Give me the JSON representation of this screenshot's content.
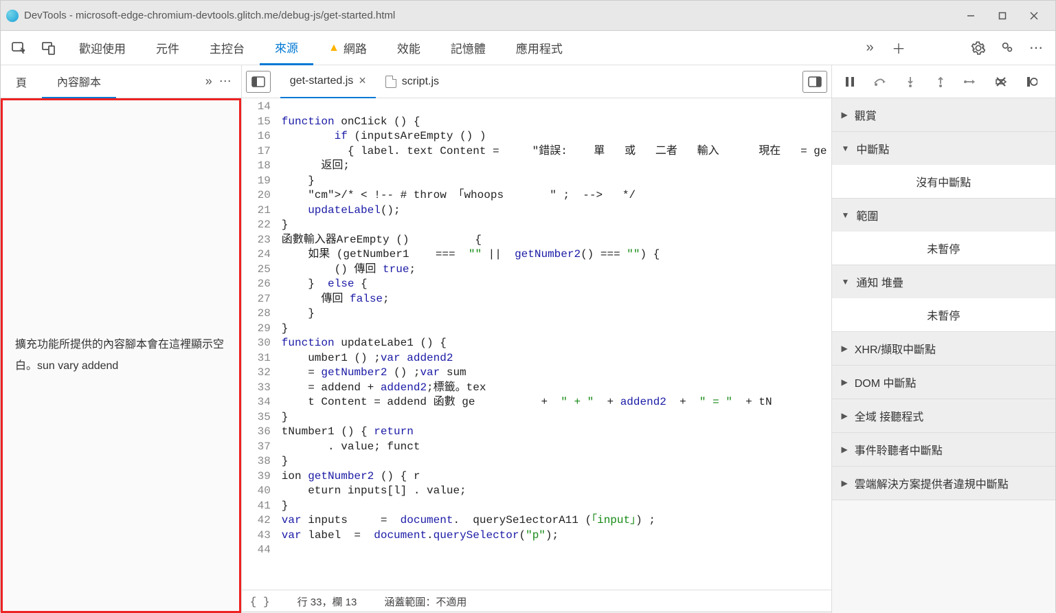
{
  "window": {
    "title": "DevTools - microsoft-edge-chromium-devtools.glitch.me/debug-js/get-started.html"
  },
  "tabs": {
    "welcome": "歡迎使用",
    "elements": "元件",
    "console": "主控台",
    "sources": "來源",
    "network": "網路",
    "performance": "效能",
    "memory": "記憶體",
    "application": "應用程式"
  },
  "left": {
    "page": "頁",
    "content_scripts": "內容腳本",
    "empty_msg": "擴充功能所提供的內容腳本會在這裡顯示空白。sun vary addend"
  },
  "files": {
    "active": "get-started.js",
    "other": "script.js"
  },
  "code_lines": [
    "",
    "function onC1ick () {",
    "        if (inputsAreEmpty () )",
    "          { label. text Content =     \"錯誤:    單   或   二者   輸入      現在   = ge",
    "      返回;",
    "    }",
    "    /* < !-- # throw 「whoops       \" ;  -->   */",
    "    updateLabel();",
    "}",
    "函數輸入器AreEmpty ()          {",
    "    如果 (getNumber1    ===  \"\" ||  getNumber2() === \"\") {",
    "        () 傳回 true;",
    "    }  else {",
    "      傳回 false;",
    "    }",
    "}",
    "function updateLabe1 () {",
    "    umber1 () ;var addend2",
    "    = getNumber2 () ;var sum",
    "    = addend + addend2;標籤。tex",
    "    t Content = addend 函數 ge          +  \" + \"  + addend2  +  \" = \"  + tN",
    "}",
    "tNumber1 () { return",
    "       . value; funct",
    "}",
    "ion getNumber2 () { r",
    "    eturn inputs[l] . value;",
    "}",
    "var inputs     =  document.  querySe1ectorA11 (「input」) ;",
    "var label  =  document.querySelector(\"p\");",
    ""
  ],
  "line_start": 14,
  "status": {
    "pos": "行 33，欄 13",
    "coverage": "涵蓋範圍：不適用"
  },
  "debugger": {
    "watch": "觀賞",
    "breakpoints": "中斷點",
    "no_breakpoints": "沒有中斷點",
    "scope": "範圍",
    "not_paused1": "未暫停",
    "callstack": "通知 堆疊",
    "not_paused2": "未暫停",
    "xhr": "XHR/擷取中斷點",
    "dom": "DOM 中斷點",
    "global": "全域    接聽程式",
    "event": "事件聆聽者中斷點",
    "csp": "雲端解決方案提供者違規中斷點"
  }
}
